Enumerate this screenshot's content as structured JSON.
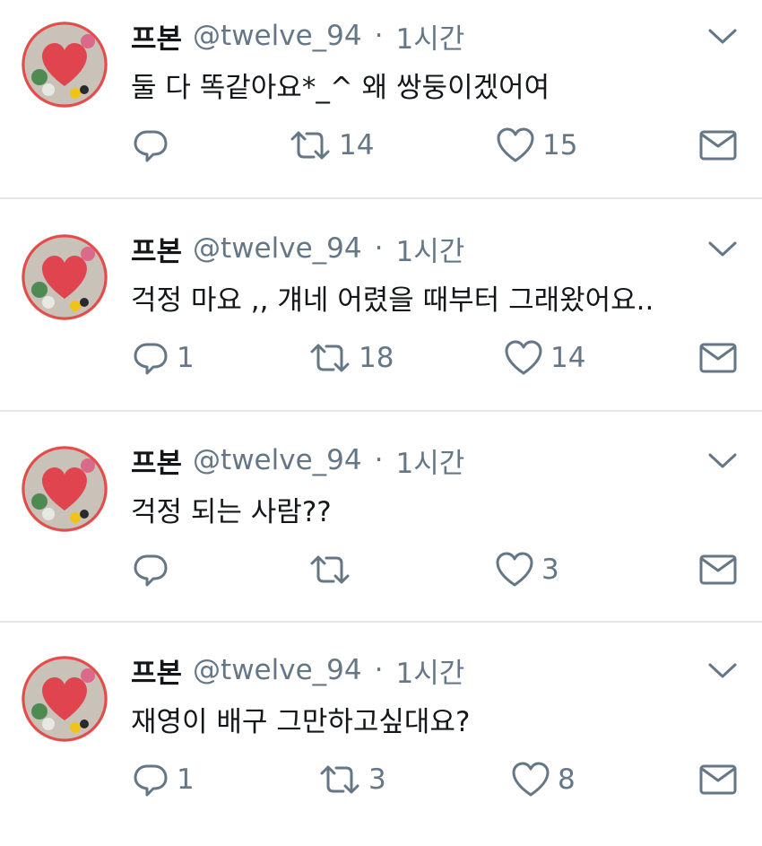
{
  "colors": {
    "text": "#14171a",
    "secondary": "#657786",
    "icon": "#657786",
    "divider": "#e1e8ed"
  },
  "tweets": [
    {
      "name": "프본",
      "handle": "@twelve_94",
      "dot": "·",
      "time": "1시간",
      "text": "둘 다 똑같아요*_^ 왜 쌍둥이겠어여",
      "reply_count": "",
      "retweet_count": "14",
      "like_count": "15"
    },
    {
      "name": "프본",
      "handle": "@twelve_94",
      "dot": "·",
      "time": "1시간",
      "text": "걱정 마요 ,, 걔네 어렸을 때부터 그래왔어요..",
      "reply_count": "1",
      "retweet_count": "18",
      "like_count": "14"
    },
    {
      "name": "프본",
      "handle": "@twelve_94",
      "dot": "·",
      "time": "1시간",
      "text": "걱정 되는 사람??",
      "reply_count": "",
      "retweet_count": "",
      "like_count": "3"
    },
    {
      "name": "프본",
      "handle": "@twelve_94",
      "dot": "·",
      "time": "1시간",
      "text": "재영이 배구 그만하고싶대요?",
      "reply_count": "1",
      "retweet_count": "3",
      "like_count": "8"
    }
  ],
  "icons": {
    "reply": "reply-icon",
    "retweet": "retweet-icon",
    "like": "heart-icon",
    "message": "envelope-icon",
    "menu": "chevron-down-icon",
    "avatar": "heart-avatar-image"
  }
}
